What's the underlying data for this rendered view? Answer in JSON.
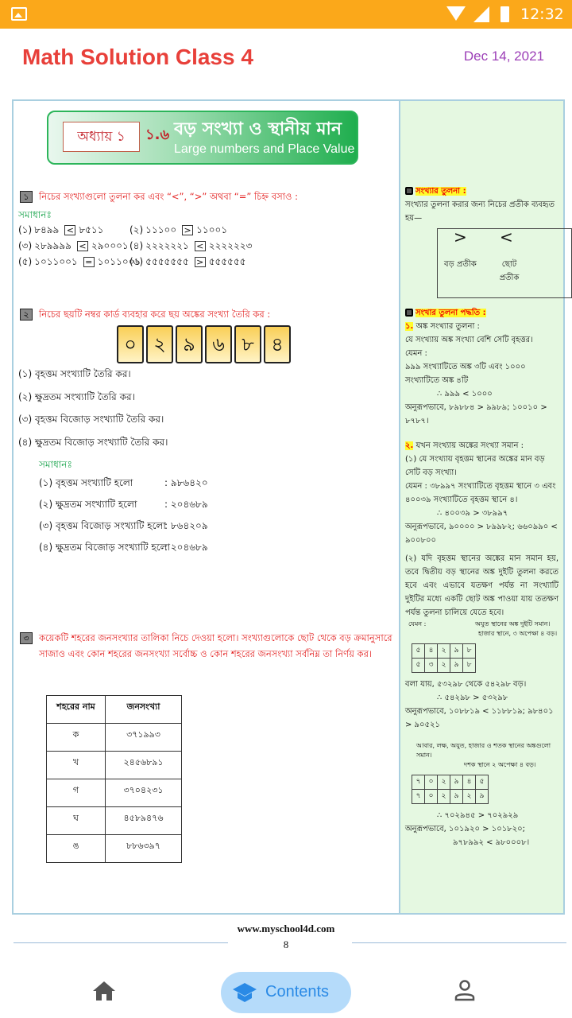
{
  "status": {
    "time": "12:32"
  },
  "header": {
    "title": "Math Solution Class 4",
    "date": "Dec 14, 2021"
  },
  "banner": {
    "chapter": "অধ্যায় ১",
    "section": "১.৬",
    "title_bn": "বড় সংখ্যা ও স্থানীয় মান",
    "title_en": "Large numbers and Place Value"
  },
  "q1": {
    "num": "১",
    "text": "নিচের সংখ্যাগুলো তুলনা কর এবং “<”, “>” অথবা “=” চিহ্ন বসাও :",
    "solution": "সমাধানঃ",
    "items": [
      {
        "n": "(১)",
        "a": "৮৪৯৯",
        "s": "<",
        "b": "৮৫১১"
      },
      {
        "n": "(২)",
        "a": "১১১০০",
        "s": ">",
        "b": "১১০০১"
      },
      {
        "n": "(৩)",
        "a": "২৮৯৯৯৯",
        "s": "<",
        "b": "২৯০০০১"
      },
      {
        "n": "(৪)",
        "a": "২২২২২২১",
        "s": "<",
        "b": "২২২২২২৩"
      },
      {
        "n": "(৫)",
        "a": "১০১১০০১",
        "s": "=",
        "b": "১০১১০০১"
      },
      {
        "n": "(৬)",
        "a": "৫৫৫৫৫৫৫",
        "s": ">",
        "b": "৫৫৫৫৫৫"
      }
    ]
  },
  "q2": {
    "num": "২",
    "text": "নিচের ছয়টি নম্বর কার্ড ব্যবহার করে ছয় অঙ্কের সংখ্যা তৈরি কর :",
    "cards": [
      "০",
      "২",
      "৯",
      "৬",
      "৮",
      "৪"
    ],
    "tasks": [
      "(১)  বৃহত্তম সংখ্যাটি তৈরি কর।",
      "(২)  ক্ষুদ্রতম সংখ্যাটি তৈরি কর।",
      "(৩)  বৃহত্তম বিজোড় সংখ্যাটি তৈরি কর।",
      "(৪)  ক্ষুদ্রতম বিজোড় সংখ্যাটি তৈরি কর।"
    ],
    "solution": "সমাধানঃ",
    "answers": [
      {
        "l": "(১)  বৃহত্তম সংখ্যাটি হলো",
        "v": ":  ৯৮৬৪২০"
      },
      {
        "l": "(২)  ক্ষুদ্রতম সংখ্যাটি হলো",
        "v": ":  ২০৪৬৮৯"
      },
      {
        "l": "(৩)  বৃহত্তম বিজোড় সংখ্যাটি হলো",
        "v": ":  ৮৬৪২০৯"
      },
      {
        "l": "(৪)  ক্ষুদ্রতম বিজোড় সংখ্যাটি হলো",
        "v": ":  ২০৪৬৮৯"
      }
    ]
  },
  "q3": {
    "num": "৩",
    "text": "কয়েকটি শহরের জনসংখ্যার তালিকা নিচে দেওয়া হলো। সংখ্যাগুলোকে ছোট থেকে বড় ক্রমানুসারে সাজাও এবং কোন শহরের জনসংখ্যা সর্বোচ্চ ও কোন শহরের জনসংখ্যা সর্বনিম্ন তা নির্ণয় কর।",
    "headers": [
      "শহরের নাম",
      "জনসংখ্যা"
    ],
    "rows": [
      [
        "ক",
        "৩৭১৯৯৩"
      ],
      [
        "খ",
        "২৪৫৬৮৯১"
      ],
      [
        "গ",
        "৩৭০৪২৩১"
      ],
      [
        "ঘ",
        "৪৫৮৯৪৭৬"
      ],
      [
        "ঙ",
        "৮৮৬৩৯৭"
      ]
    ]
  },
  "side": {
    "h1": "সংখ্যার তুলনা :",
    "p1": "সংখ্যার তুলনা করার জন্য নিচের প্রতীক ব্যবহৃত হয়—",
    "gt": ">",
    "lt": "<",
    "gt_label": "বড় প্রতীক",
    "lt_label": "ছোট প্রতীক",
    "h2": "সংখার তুলনা পদ্ধতি :",
    "s1n": "১.",
    "s1": "অঙ্ক সংখ্যার তুলনা :",
    "s1lines": [
      "যে সংখ্যায় অঙ্ক সংখ্যা বেশি সেটি বৃহত্তর।",
      "যেমন :",
      "৯৯৯ সংখ্যাটিতে অঙ্ক ৩টি এবং ১০০০ সংখ্যাটিতে অঙ্ক ৪টি",
      "∴ ৯৯৯ < ১০০০",
      "অনুরূপভাবে, ৮৯৮৮৪ > ৯৯৮৯; ১০০১০ > ৮৭৮৭।"
    ],
    "s2n": "২.",
    "s2": "যখন সংখ্যায় অঙ্কের সংখ্যা সমান :",
    "s2lines": [
      "(১) যে সংখ্যায় বৃহত্তম স্থানের অঙ্কের মান বড় সেটি বড় সংখ্যা।",
      "যেমন : ৩৮৯৯৭ সংখ্যাটিতে বৃহত্তম স্থানে ৩ এবং ৪০০৩৯ সংখ্যাটিতে বৃহত্তম স্থানে ৪।",
      "∴ ৪০০৩৯ > ৩৮৯৯৭",
      "অনুরূপভাবে, ৯০০০০ > ৮৯৯৮২; ৬৬০৯৯০ < ৯০০৮০০"
    ],
    "s2p2": "(২) যদি বৃহত্তম স্থানের অঙ্কের মান সমান হয়, তবে দ্বিতীয় বড় স্থানের অঙ্ক দুইটি তুলনা করতে হবে এবং এভাবে যতক্ষণ পর্যন্ত না সংখ্যাটি দুইটির মধ্যে একটি ছোট অঙ্ক পাওয়া যায় ততক্ষণ পর্যন্ত তুলনা চালিয়ে যেতে হবে।",
    "ex1label": "যেমন :",
    "ex1a": "অযুত স্থানের অঙ্ক দুইটি সমান।",
    "ex1b": "হাজার স্থানে, ৩ অপেক্ষা ৪ বড়।",
    "grid1": [
      [
        "৫",
        "৪",
        "২",
        "৯",
        "৮"
      ],
      [
        "৫",
        "৩",
        "২",
        "৯",
        "৮"
      ]
    ],
    "ex1lines": [
      "বলা যায়, ৫৩২৯৮ থেকে ৫৪২৯৮ বড়।",
      "∴ ৫৪২৯৮ > ৫৩২৯৮",
      "অনুরূপভাবে, ১০৮৮১৯ < ১১৮৮১৯; ৯৮৪০১ > ৯০৫২১"
    ],
    "ex2label": "আবার,",
    "ex2a": "লক্ষ, অযুত, হাজার ও শতক স্থানের অঙ্কগুলো সমান।",
    "ex2b": "দশক স্থানে ২ অপেক্ষা ৪ বড়।",
    "grid2": [
      [
        "৭",
        "০",
        "২",
        "৯",
        "৪",
        "৫"
      ],
      [
        "৭",
        "০",
        "২",
        "৯",
        "২",
        "৯"
      ]
    ],
    "ex2lines": [
      "∴ ৭০২৯৪৫ > ৭০২৯২৯",
      "অনুরূপভাবে, ১০১৯২০ > ১০১৮২০;",
      "৯৭৮৯৯২ < ৯৮০০০৮।"
    ]
  },
  "footer": {
    "site": "www.myschool4d.com",
    "page": "8"
  },
  "nav": {
    "contents": "Contents"
  }
}
